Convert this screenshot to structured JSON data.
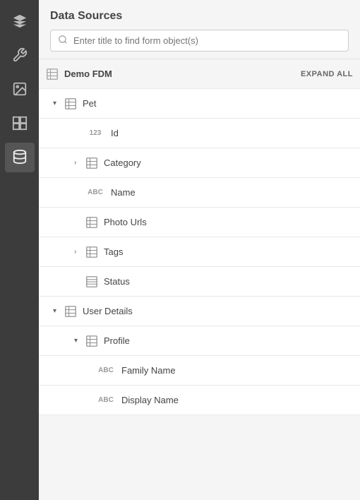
{
  "sidebar": {
    "items": [
      {
        "id": "layers",
        "icon": "layers-icon",
        "active": false
      },
      {
        "id": "wrench",
        "icon": "wrench-icon",
        "active": false
      },
      {
        "id": "image-block",
        "icon": "image-block-icon",
        "active": false
      },
      {
        "id": "components",
        "icon": "components-icon",
        "active": false
      },
      {
        "id": "datasources",
        "icon": "datasources-icon",
        "active": true
      }
    ]
  },
  "panel": {
    "title": "Data Sources",
    "search": {
      "placeholder": "Enter title to find form object(s)"
    },
    "expandAll": "EXPAND ALL",
    "tree": [
      {
        "id": "demo-fdm",
        "level": 0,
        "label": "Demo FDM",
        "type": "table",
        "expandable": false,
        "expanded": false
      },
      {
        "id": "pet",
        "level": 1,
        "label": "Pet",
        "type": "table",
        "expandable": true,
        "expanded": true,
        "chevron": "▾"
      },
      {
        "id": "id",
        "level": 2,
        "label": "Id",
        "type": "123",
        "expandable": false,
        "expanded": false
      },
      {
        "id": "category",
        "level": 2,
        "label": "Category",
        "type": "table",
        "expandable": true,
        "expanded": false,
        "chevron": "›"
      },
      {
        "id": "name",
        "level": 2,
        "label": "Name",
        "type": "ABC",
        "expandable": false,
        "expanded": false
      },
      {
        "id": "photo-urls",
        "level": 2,
        "label": "Photo Urls",
        "type": "table",
        "expandable": false,
        "expanded": false
      },
      {
        "id": "tags",
        "level": 2,
        "label": "Tags",
        "type": "table",
        "expandable": true,
        "expanded": false,
        "chevron": "›"
      },
      {
        "id": "status",
        "level": 2,
        "label": "Status",
        "type": "table-lines",
        "expandable": false,
        "expanded": false
      },
      {
        "id": "user-details",
        "level": 1,
        "label": "User Details",
        "type": "table",
        "expandable": true,
        "expanded": true,
        "chevron": "▾"
      },
      {
        "id": "profile",
        "level": 2,
        "label": "Profile",
        "type": "table",
        "expandable": true,
        "expanded": true,
        "chevron": "▾"
      },
      {
        "id": "family-name",
        "level": 3,
        "label": "Family Name",
        "type": "ABC",
        "expandable": false,
        "expanded": false
      },
      {
        "id": "display-name",
        "level": 3,
        "label": "Display Name",
        "type": "ABC",
        "expandable": false,
        "expanded": false
      }
    ]
  }
}
